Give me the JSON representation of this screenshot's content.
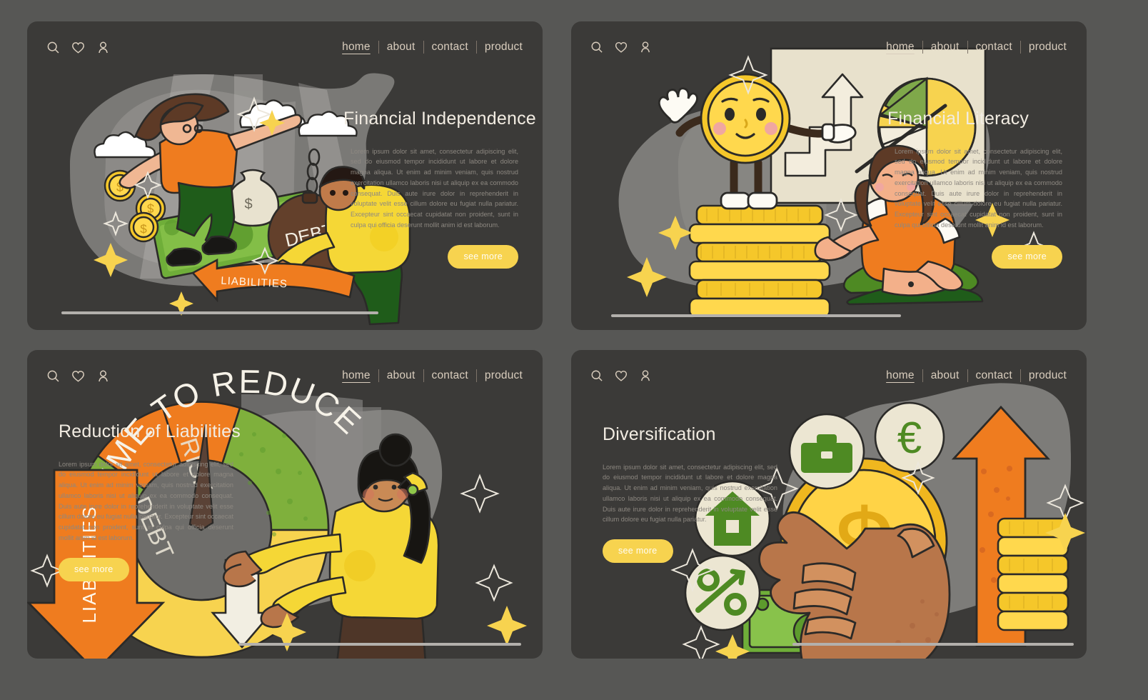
{
  "palette": {
    "page_bg": "#575755",
    "panel_bg": "#3b3a38",
    "title": "#f2ece2",
    "body_text": "#8d8881",
    "nav_text": "#d9cdbd",
    "accent_yellow": "#f7d34f",
    "accent_orange": "#ef7c1f",
    "accent_green": "#3f7a1e",
    "gold": "#f5c72a",
    "blob_grey": "#7d7c79",
    "ground": "#b3b0ac"
  },
  "nav": {
    "icons": [
      {
        "name": "search-icon",
        "label": "search"
      },
      {
        "name": "heart-icon",
        "label": "favorites"
      },
      {
        "name": "user-icon",
        "label": "account"
      }
    ],
    "links": [
      {
        "label": "home",
        "active": true
      },
      {
        "label": "about",
        "active": false
      },
      {
        "label": "contact",
        "active": false
      },
      {
        "label": "product",
        "active": false
      }
    ]
  },
  "common": {
    "cta_label": "see more",
    "lorem_full": "Lorem ipsum dolor sit amet, consectetur adipiscing elit, sed do eiusmod tempor incididunt ut labore et dolore magna aliqua. Ut enim ad minim veniam, quis nostrud exercitation ullamco laboris nisi ut aliquip ex ea commodo consequat. Duis aute irure dolor in reprehenderit in voluptate velit esse cillum dolore eu fugiat nulla pariatur. Excepteur sint occaecat cupidatat non proident, sunt in culpa qui officia deserunt mollit anim id est laborum.",
    "lorem_short": "Lorem ipsum dolor sit amet, consectetur adipiscing elit, sed do eiusmod tempor incididunt ut labore et dolore magna aliqua. Ut enim ad minim veniam, quis nostrud exercitation ullamco laboris nisi ut aliquip ex ea commodo consequat. Duis aute irure dolor in reprehenderit in voluptate velit esse cillum dolore eu fugiat nulla pariatur."
  },
  "panels": [
    {
      "id": "financial-independence",
      "title": "Financial Independence",
      "text_side": "right",
      "illustration": {
        "name": "woman-surfing-money-with-debt-ball",
        "labels": [
          "DEBT",
          "LIABILITIES"
        ],
        "coin_symbol": "$",
        "money_bag_symbol": "$"
      }
    },
    {
      "id": "financial-literacy",
      "title": "Financial Literacy",
      "text_side": "right",
      "illustration": {
        "name": "coin-mascot-teaching-pie-chart",
        "labels": [],
        "chart": "pie-chart-and-up-arrow"
      }
    },
    {
      "id": "reduction-of-liabilities",
      "title": "Reduction of Liabilities",
      "text_side": "left",
      "illustration": {
        "name": "woman-turning-debt-risk-gauge-down",
        "labels": [
          "TIME TO REDUCE",
          "DEBT RISK",
          "LIABILITIES"
        ]
      }
    },
    {
      "id": "diversification",
      "title": "Diversification",
      "text_side": "left",
      "illustration": {
        "name": "hand-holding-dollar-coin-with-asset-icons",
        "icon_badges": [
          "briefcase-icon",
          "euro-icon",
          "house-icon",
          "percent-icon"
        ],
        "coin_symbol": "$",
        "euro_symbol": "€",
        "percent_symbol": "%"
      }
    }
  ]
}
